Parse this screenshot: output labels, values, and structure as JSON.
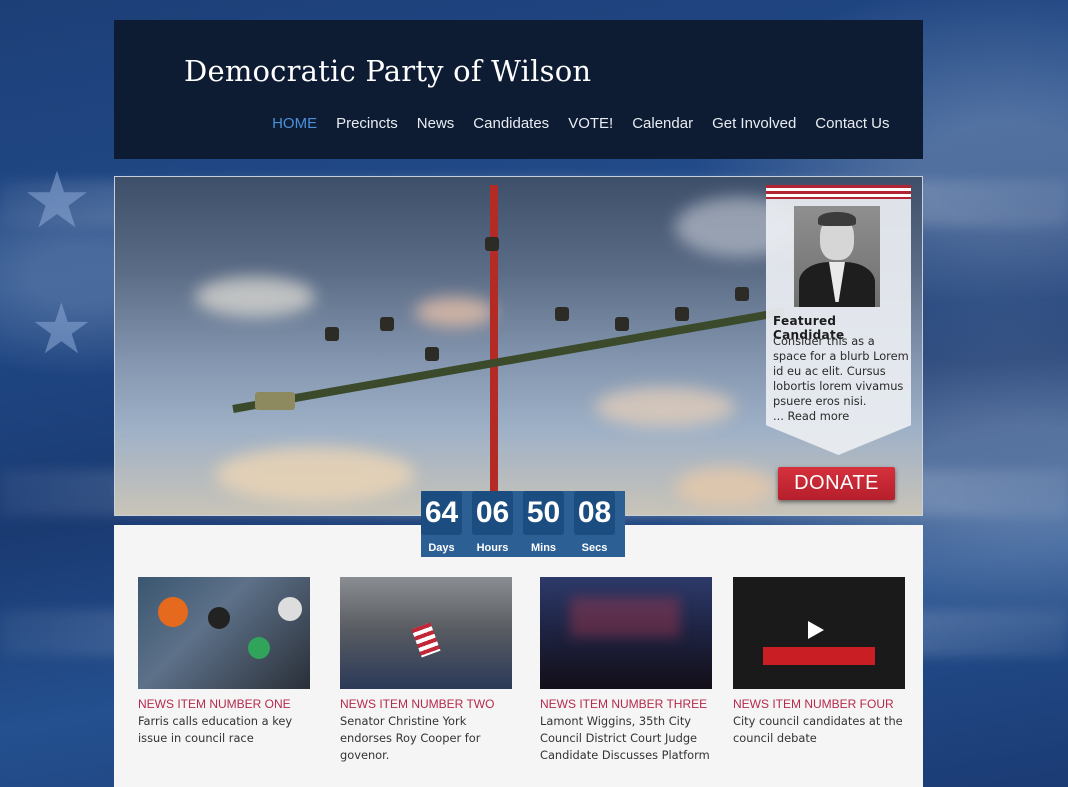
{
  "header": {
    "site_title": "Democratic Party of Wilson",
    "nav": [
      "HOME",
      "Precincts",
      "News",
      "Candidates",
      "VOTE!",
      "Calendar",
      "Get Involved",
      "Contact Us"
    ],
    "active_nav": "HOME"
  },
  "featured": {
    "title": "Featured Candidate",
    "blurb": "Consider this as a space for a blurb Lorem  id eu ac elit.  Cursus lobortis lorem vivamus psuere eros nisi.",
    "read_more": "... Read more"
  },
  "donate_label": "DONATE",
  "countdown": [
    {
      "value": "64",
      "label": "Days"
    },
    {
      "value": "06",
      "label": "Hours"
    },
    {
      "value": "50",
      "label": "Mins"
    },
    {
      "value": "08",
      "label": "Secs"
    }
  ],
  "news": [
    {
      "headline": "NEWS ITEM NUMBER ONE",
      "text": "Farris calls education a key issue in council race"
    },
    {
      "headline": "NEWS ITEM NUMBER TWO",
      "text": "Senator Christine York endorses Roy Cooper for govenor."
    },
    {
      "headline": "NEWS ITEM NUMBER THREE",
      "text": "Lamont Wiggins, 35th City Council District Court Judge Candidate Discusses Platform"
    },
    {
      "headline": "NEWS ITEM NUMBER FOUR",
      "text": "City council candidates at the council debate"
    }
  ],
  "colors": {
    "header_bg": "#0e1c33",
    "nav_active": "#4a90d9",
    "donate": "#c42733",
    "countdown": "#1b4d80",
    "news_headline": "#b52a4c"
  }
}
